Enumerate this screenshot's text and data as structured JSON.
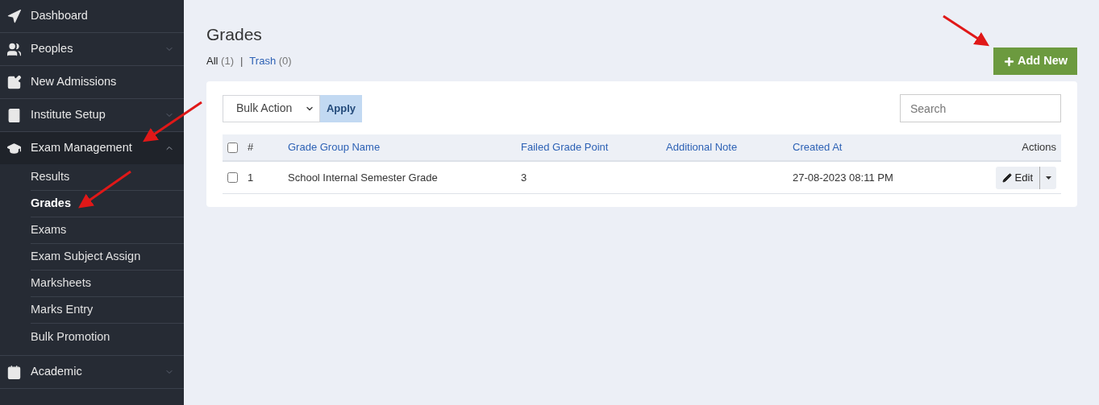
{
  "sidebar": {
    "items": [
      {
        "label": "Dashboard"
      },
      {
        "label": "Peoples",
        "expanded": false
      },
      {
        "label": "New Admissions"
      },
      {
        "label": "Institute Setup",
        "expanded": false
      },
      {
        "label": "Exam Management",
        "expanded": true,
        "children": [
          {
            "label": "Results",
            "selected": false
          },
          {
            "label": "Grades",
            "selected": true
          },
          {
            "label": "Exams",
            "selected": false
          },
          {
            "label": "Exam Subject Assign",
            "selected": false
          },
          {
            "label": "Marksheets",
            "selected": false
          },
          {
            "label": "Marks Entry",
            "selected": false
          },
          {
            "label": "Bulk Promotion",
            "selected": false
          }
        ]
      },
      {
        "label": "Academic",
        "expanded": false
      }
    ]
  },
  "page": {
    "title": "Grades",
    "add_button": "Add New",
    "filters": [
      {
        "label": "All",
        "count": "(1)",
        "selected": true
      },
      {
        "label": "Trash",
        "count": "(0)",
        "selected": false
      }
    ],
    "separator": "|"
  },
  "toolbar": {
    "bulk_select": "Bulk Action",
    "apply": "Apply",
    "search": {
      "placeholder": "Search"
    }
  },
  "table": {
    "columns": [
      "#",
      "Grade Group Name",
      "Failed Grade Point",
      "Additional Note",
      "Created At",
      "Actions"
    ],
    "select_all": false,
    "rows": [
      {
        "checked": false,
        "cells": [
          "1",
          "School Internal Semester Grade",
          "3",
          "",
          "27-08-2023 08:11 PM"
        ],
        "action": "Edit"
      }
    ]
  }
}
